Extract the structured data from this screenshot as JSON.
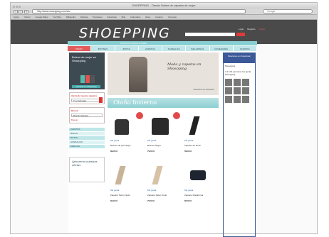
{
  "browser": {
    "title": "SHOEPPING - Tienda Online de zapatos de mujer",
    "address": "http://www.shoepping.com/es/",
    "search_placeholder": "Google",
    "bookmarks": [
      "Apple",
      "Yahoo!",
      "Google Maps",
      "YouTube",
      "Wikipedia",
      "Noticias",
      "Populares",
      "Facebook",
      "Mail",
      "Calendario",
      "Ebay",
      "Amazon",
      "Compras"
    ]
  },
  "site": {
    "logo": "SHOEPPING",
    "header_links": [
      "Login",
      "Registro",
      "Carrito"
    ],
    "strip_text": "ZAPATOS ONLINE STORE",
    "nav": [
      "INICIO",
      "BOTINES",
      "BOTAS",
      "ZAPATOS",
      "SANDALIAS",
      "BAILARINAS",
      "NOVEDADES",
      "OFERTAS"
    ],
    "promo_title": "Bolsos de mujer en Shoepping",
    "promo_button": "Comprar en Shoepping",
    "box1_title": "Alerta de nuevos zapatos",
    "box1_text": "Tu email aquí",
    "box2_title": "Buscar",
    "box2_input": "Buscar Zapatos",
    "box2_link": "Buscar",
    "categories": [
      "ZAPATOS",
      "Botines",
      "BOTAS",
      "SANDALIAS",
      "MARCAS"
    ],
    "ad_text": "Aprovecha nuestras ofertas",
    "hero_title": "Moda y zapatos en Shoepping",
    "hero_sub": "Descubre la colección",
    "section_title": "Otoño Invierno",
    "products": [
      {
        "name": "Botines de piel Negro",
        "price": "89,00 €"
      },
      {
        "name": "Botines Negro",
        "price": "79,00 €"
      },
      {
        "name": "Zapatos de tacón",
        "price": "59,00 €"
      },
      {
        "name": "Zapatos Tacón Nude",
        "price": "69,00 €"
      },
      {
        "name": "Zapatos Salón Nude",
        "price": "75,00 €"
      },
      {
        "name": "Zapatos Plataforma",
        "price": "65,00 €"
      }
    ],
    "product_buttons": "Me gusta",
    "fb_header": "Búscanos en Facebook",
    "fb_name": "Shoepping",
    "fb_text": "A 2.134 personas les gusta Shoepping"
  }
}
